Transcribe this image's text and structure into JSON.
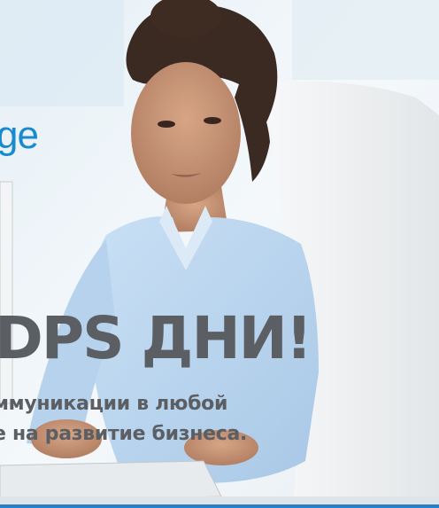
{
  "banner": {
    "brand_fragment": "ge",
    "headline": "DPS ДНИ!",
    "subline_1": "ммуникации   в   любой",
    "subline_2": "е на развитие бизнеса."
  },
  "colors": {
    "brand_blue": "#1a8ad0",
    "headline_gray": "#5b5e63",
    "shirt_blue": "#bcd8f2",
    "background": "#eef4f8"
  }
}
